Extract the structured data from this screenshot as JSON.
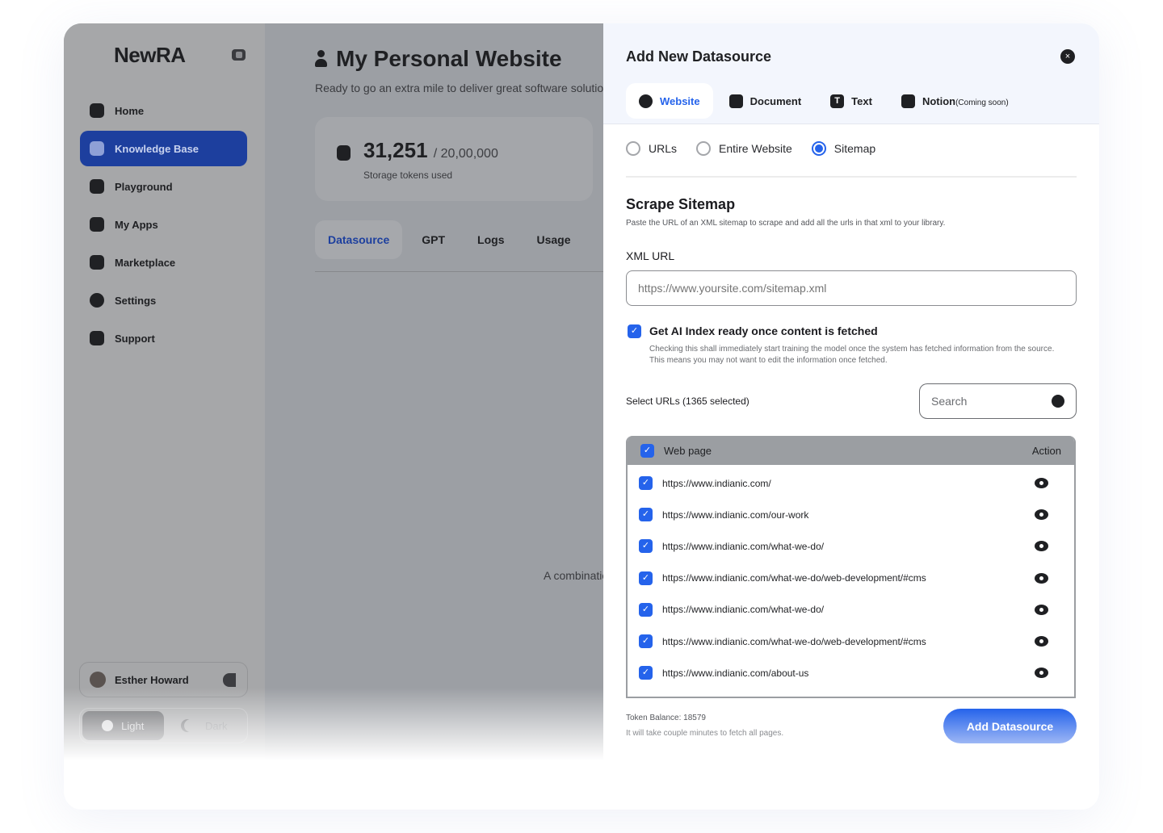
{
  "sidebar": {
    "logo": "NewRA",
    "items": [
      {
        "label": "Home"
      },
      {
        "label": "Knowledge Base"
      },
      {
        "label": "Playground"
      },
      {
        "label": "My Apps"
      },
      {
        "label": "Marketplace"
      },
      {
        "label": "Settings"
      },
      {
        "label": "Support"
      }
    ],
    "user": "Esther Howard",
    "theme": {
      "light": "Light",
      "dark": "Dark"
    }
  },
  "main": {
    "title": "My Personal Website",
    "subtitle": "Ready to go an extra mile to deliver great software solutions",
    "tokens_used": "31,251",
    "tokens_total": "/ 20,00,000",
    "tokens_label": "Storage tokens used",
    "tabs": [
      "Datasource",
      "GPT",
      "Logs",
      "Usage"
    ],
    "body_text": "A combination"
  },
  "panel": {
    "title": "Add New Datasource",
    "close": "×",
    "tabs": [
      {
        "label": "Website"
      },
      {
        "label": "Document"
      },
      {
        "label": "Text"
      },
      {
        "label": "Notion",
        "note": "(Coming soon)"
      }
    ],
    "modes": [
      "URLs",
      "Entire Website",
      "Sitemap"
    ],
    "selected_mode": "Sitemap",
    "section_title": "Scrape Sitemap",
    "section_desc": "Paste the URL of an XML sitemap to scrape and add all the urls in that xml to your library.",
    "xml_label": "XML URL",
    "xml_placeholder": "https://www.yoursite.com/sitemap.xml",
    "ai_index": {
      "label": "Get AI Index ready once content is fetched",
      "checked": true,
      "desc": "Checking this shall immediately start training the model once the system has fetched information from the source. This means you may not want to edit the information once fetched."
    },
    "select_label": "Select URLs (1365 selected)",
    "search_placeholder": "Search",
    "table": {
      "col_page": "Web page",
      "col_action": "Action",
      "rows": [
        "https://www.indianic.com/",
        "https://www.indianic.com/our-work",
        "https://www.indianic.com/what-we-do/",
        "https://www.indianic.com/what-we-do/web-development/#cms",
        "https://www.indianic.com/what-we-do/",
        "https://www.indianic.com/what-we-do/web-development/#cms",
        "https://www.indianic.com/about-us"
      ]
    },
    "token_balance": "Token Balance: 18579",
    "fetch_note": "It will take couple minutes to fetch all pages.",
    "submit": "Add Datasource",
    "check": "✓",
    "accent": "#2563eb"
  }
}
